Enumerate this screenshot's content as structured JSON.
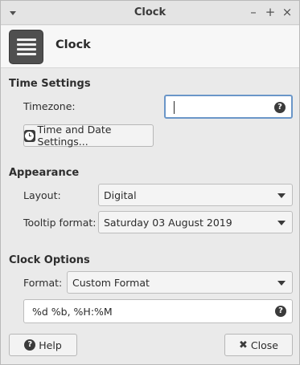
{
  "window": {
    "title": "Clock",
    "menu_icon": "chevron-down-icon",
    "minimize_label": "–",
    "maximize_label": "+",
    "close_label": "×"
  },
  "header": {
    "app_icon": "list-icon",
    "title": "Clock"
  },
  "time_settings": {
    "heading": "Time Settings",
    "timezone_label": "Timezone:",
    "timezone_value": "",
    "help_glyph": "?",
    "time_date_button": "Time and Date Settings..."
  },
  "appearance": {
    "heading": "Appearance",
    "layout_label": "Layout:",
    "layout_value": "Digital",
    "tooltip_label": "Tooltip format:",
    "tooltip_value": "Saturday 03 August 2019"
  },
  "clock_options": {
    "heading": "Clock Options",
    "format_label": "Format:",
    "format_value": "Custom Format",
    "custom_format_value": "%d %b, %H:%M",
    "help_glyph": "?"
  },
  "footer": {
    "help_button": "Help",
    "help_glyph": "?",
    "close_button": "Close",
    "close_glyph": "✖"
  },
  "colors": {
    "focus_border": "#6a96c8",
    "window_bg": "#eaeaea"
  }
}
